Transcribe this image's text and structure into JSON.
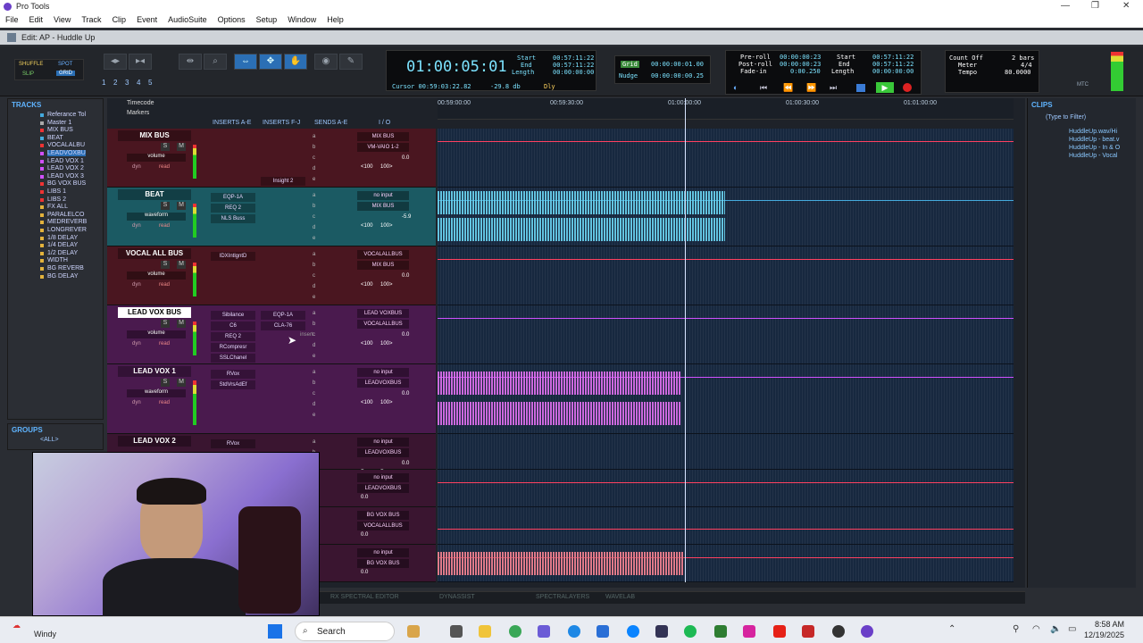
{
  "window": {
    "title": "Pro Tools",
    "edit_title": "Edit: AP - Huddle Up"
  },
  "menu": [
    "File",
    "Edit",
    "View",
    "Track",
    "Clip",
    "Event",
    "AudioSuite",
    "Options",
    "Setup",
    "Window",
    "Help"
  ],
  "toolbar": {
    "modes": [
      "SHUFFLE",
      "SPOT",
      "SLIP",
      "GRID"
    ],
    "zoom_presets": [
      "1",
      "2",
      "3",
      "4",
      "5"
    ],
    "main_counter": "01:00:05:01",
    "cursor": "Cursor 00:59:03:22.82",
    "cursor_db": "-29.8 db",
    "start_label": "Start",
    "end_label": "End",
    "length_label": "Length",
    "start": "00:57:11:22",
    "end": "00:57:11:22",
    "length": "00:00:00:00",
    "grid_label": "Grid",
    "grid_value": "00:00:00:01.00",
    "nudge_label": "Nudge",
    "nudge_value": "00:00:00:00.25",
    "preroll_label": "Pre-roll",
    "postroll_label": "Post-roll",
    "fadein_label": "Fade-in",
    "preroll": "00:00:00:23",
    "postroll": "00:00:00:23",
    "fadein": "0:00.250",
    "t_start": "00:57:11:22",
    "t_end": "00:57:11:22",
    "t_length": "00:00:00:00",
    "count_off": "Count Off",
    "bars": "2 bars",
    "meter_label": "Meter",
    "meter": "4/4",
    "tempo_label": "Tempo",
    "tempo": "80.0000",
    "mtc": "MTC",
    "dly": "Dly"
  },
  "tracks_panel": {
    "title": "TRACKS",
    "items": [
      "Referance Tol",
      "Master 1",
      "MIX BUS",
      "BEAT",
      "VOCALALBU",
      "LEADVOXBU",
      "LEAD VOX 1",
      "LEAD VOX 2",
      "LEAD VOX 3",
      "BG VOX BUS",
      "LIBS 1",
      "LIBS 2",
      "FX ALL",
      "PARALELCO",
      "MEDREVERB",
      "LONGREVER",
      "1/8 DELAY",
      "1/4 DELAY",
      "1/2 DELAY",
      "WIDTH",
      "BG REVERB",
      "BG DELAY"
    ]
  },
  "groups_panel": {
    "title": "GROUPS",
    "item": "<ALL>"
  },
  "edit_header": {
    "tracks": "Timecode",
    "markers": "Markers",
    "inserts_ae": "INSERTS A-E",
    "inserts_fj": "INSERTS F-J",
    "sends_ae": "SENDS A-E",
    "io": "I / O"
  },
  "tracks": [
    {
      "name": "MIX BUS",
      "view": "volume",
      "dyn": "dyn",
      "mode": "read",
      "inserts_ae": [],
      "inserts_fj": [
        "Insight 2"
      ],
      "io_in": "MIX BUS",
      "io_out": "VM-VAIO 1-2",
      "vol": "0.0",
      "pan": "<100",
      "pan2": "100>",
      "color": "#4a1620",
      "line": "#ff4060"
    },
    {
      "name": "BEAT",
      "view": "waveform",
      "dyn": "dyn",
      "mode": "read",
      "inserts_ae": [
        "EQP-1A",
        "REQ 2",
        "NLS Buss"
      ],
      "inserts_fj": [],
      "io_in": "no input",
      "io_out": "MIX BUS",
      "vol": "-5.9",
      "pan": "<100",
      "pan2": "100>",
      "color": "#1b5a63",
      "line": "#4ad"
    },
    {
      "name": "VOCAL ALL BUS",
      "view": "volume",
      "dyn": "dyn",
      "mode": "read",
      "inserts_ae": [
        "IDXIntlgntD"
      ],
      "inserts_fj": [],
      "io_in": "VOCALALLBUS",
      "io_out": "MIX BUS",
      "vol": "0.0",
      "pan": "<100",
      "pan2": "100>",
      "color": "#4a1620",
      "line": "#ff4060"
    },
    {
      "name": "LEAD VOX BUS",
      "view": "volume",
      "dyn": "dyn",
      "mode": "read",
      "inserts_ae": [
        "Sibilance",
        "C6",
        "REQ 2",
        "RCompresr",
        "SSLChanel"
      ],
      "inserts_fj": [
        "EQP-1A",
        "CLA-76"
      ],
      "io_in": "LEAD VOXBUS",
      "io_out": "VOCALALLBUS",
      "vol": "0.0",
      "pan": "<100",
      "pan2": "100>",
      "color": "#4a1a4e",
      "line": "#d050ff",
      "ghost": "insert"
    },
    {
      "name": "LEAD VOX 1",
      "view": "waveform",
      "dyn": "dyn",
      "mode": "read",
      "inserts_ae": [
        "RVox",
        "StdVrsAdEf"
      ],
      "inserts_fj": [],
      "io_in": "no input",
      "io_out": "LEADVOXBUS",
      "vol": "0.0",
      "pan": "<100",
      "pan2": "100>",
      "color": "#4a1a4e",
      "line": "#d050ff"
    },
    {
      "name": "LEAD VOX 2",
      "inserts_ae": [
        "RVox"
      ],
      "io_in": "no input",
      "io_out": "LEADVOXBUS",
      "vol": "0.0",
      "pan": "P",
      "pan2": "P",
      "color": "#3a1530"
    }
  ],
  "lower_rows": [
    {
      "io_in": "no input",
      "io_out": "LEADVOXBUS",
      "vol": "0.0"
    },
    {
      "io_in": "BG VOX BUS",
      "io_out": "VOCALALLBUS",
      "vol": "0.0"
    },
    {
      "io_in": "no input",
      "io_out": "BG VOX BUS",
      "vol": "0.0"
    }
  ],
  "ruler": {
    "marks": [
      "00:59:00:00",
      "00:59:30:00",
      "01:00:00:00",
      "01:00:30:00",
      "01:01:00:00"
    ]
  },
  "clips_panel": {
    "title": "CLIPS",
    "filter": "(Type to Filter)",
    "items": [
      "HuddleUp.wav/Hi",
      "HuddleUp - beat.v",
      "HuddleUp - In & O",
      "HuddleUp - Vocal"
    ]
  },
  "bottom_bar": [
    "RX SPECTRAL EDITOR",
    "DYNASSIST",
    "SPECTRALAYERS",
    "WAVELAB"
  ],
  "taskbar": {
    "weather": "Windy",
    "search": "Search",
    "time": "8:58 AM",
    "date": "12/19/2025"
  }
}
